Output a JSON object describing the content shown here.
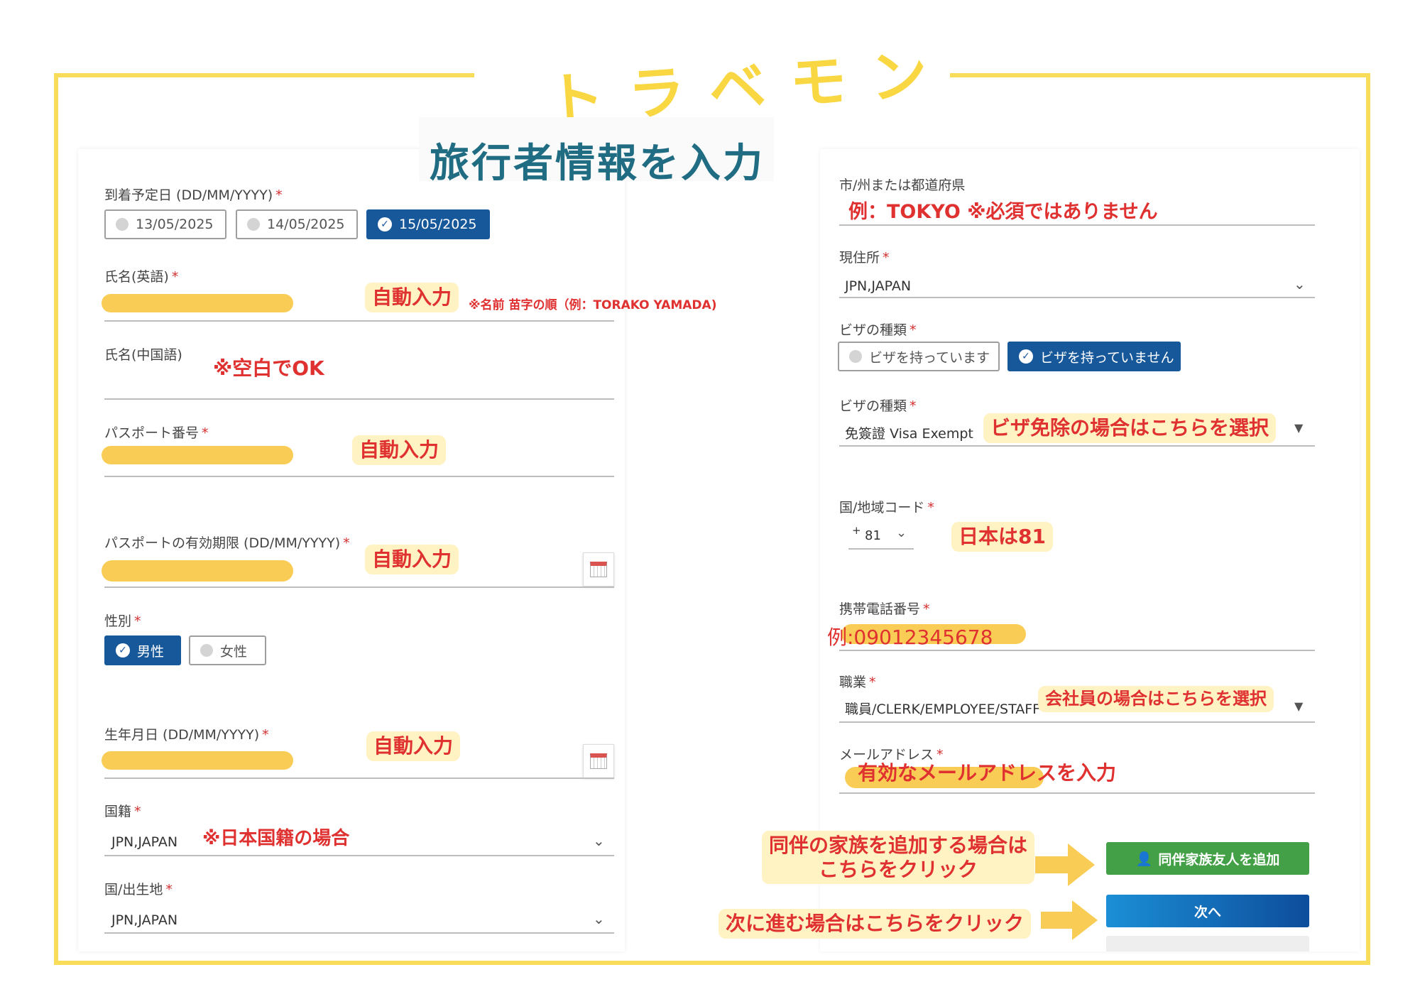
{
  "brand": {
    "logo": "トラベモン",
    "title": "旅行者情報を入力"
  },
  "left": {
    "arrival": {
      "label": "到着予定日 (DD/MM/YYYY)",
      "options": [
        "13/05/2025",
        "14/05/2025",
        "15/05/2025"
      ],
      "selected_index": 2
    },
    "name_en": {
      "label": "氏名(英語)",
      "tag": "自動入力",
      "note": "※名前 苗字の順（例：TORAKO YAMADA)"
    },
    "name_cn": {
      "label": "氏名(中国語)",
      "note": "※空白でOK"
    },
    "passport_no": {
      "label": "パスポート番号",
      "tag": "自動入力"
    },
    "passport_exp": {
      "label": "パスポートの有効期限 (DD/MM/YYYY)",
      "tag": "自動入力"
    },
    "gender": {
      "label": "性別",
      "options": [
        "男性",
        "女性"
      ],
      "selected_index": 0
    },
    "birth": {
      "label": "生年月日 (DD/MM/YYYY)",
      "tag": "自動入力"
    },
    "nationality": {
      "label": "国籍",
      "value": "JPN,JAPAN",
      "note": "※日本国籍の場合"
    },
    "birthplace": {
      "label": "国/出生地",
      "value": "JPN,JAPAN"
    }
  },
  "right": {
    "city": {
      "label": "市/州または都道府県",
      "note": "例：TOKYO ※必須ではありません"
    },
    "residence": {
      "label": "現住所",
      "value": "JPN,JAPAN"
    },
    "visa_have": {
      "label": "ビザの種類",
      "options": [
        "ビザを持っています",
        "ビザを持っていません"
      ],
      "selected_index": 1
    },
    "visa_type": {
      "label": "ビザの種類",
      "value": "免簽證 Visa Exempt",
      "tag": "ビザ免除の場合はこちらを選択"
    },
    "country_code": {
      "label": "国/地域コード",
      "plus": "+",
      "value": "81",
      "tag": "日本は81"
    },
    "mobile": {
      "label": "携帯電話番号",
      "example": "例:09012345678"
    },
    "job": {
      "label": "職業",
      "value": "職員/CLERK/EMPLOYEE/STAFF",
      "tag": "会社員の場合はこちらを選択"
    },
    "email": {
      "label": "メールアドレス",
      "tag": "有効なメールアドレスを入力"
    },
    "add_companion": {
      "note_line1": "同伴の家族を追加する場合は",
      "note_line2": "こちらをクリック",
      "button": "同伴家族友人を追加"
    },
    "next": {
      "note": "次に進む場合はこちらをクリック",
      "button": "次へ"
    }
  },
  "colors": {
    "frame": "#f8dc5a",
    "selected": "#17589b",
    "highlight": "#f9cd55",
    "annotation": "#e03131",
    "add_button": "#43a047"
  },
  "icons": [
    "check-circle-icon",
    "radio-off-icon",
    "chevron-down-icon",
    "calendar-icon",
    "caret-down-icon",
    "arrow-right-icon",
    "person-add-icon"
  ]
}
